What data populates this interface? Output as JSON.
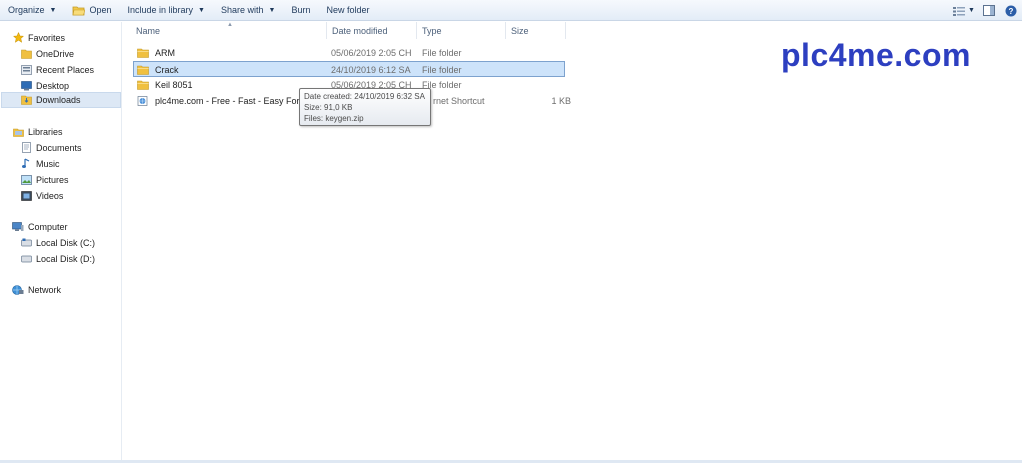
{
  "toolbar": {
    "organize": "Organize",
    "open": "Open",
    "include_in_library": "Include in library",
    "share_with": "Share with",
    "burn": "Burn",
    "new_folder": "New folder"
  },
  "nav": {
    "favorites": "Favorites",
    "onedrive": "OneDrive",
    "recent_places": "Recent Places",
    "desktop": "Desktop",
    "downloads": "Downloads",
    "libraries": "Libraries",
    "documents": "Documents",
    "music": "Music",
    "pictures": "Pictures",
    "videos": "Videos",
    "computer": "Computer",
    "local_c": "Local Disk (C:)",
    "local_d": "Local Disk (D:)",
    "network": "Network"
  },
  "columns": {
    "name": "Name",
    "date_modified": "Date modified",
    "type": "Type",
    "size": "Size"
  },
  "files": [
    {
      "name": "ARM",
      "date": "05/06/2019 2:05 CH",
      "type": "File folder",
      "size": ""
    },
    {
      "name": "Crack",
      "date": "24/10/2019 6:12 SA",
      "type": "File folder",
      "size": ""
    },
    {
      "name": "Keil 8051",
      "date": "05/06/2019 2:05 CH",
      "type": "File folder",
      "size": ""
    },
    {
      "name": "plc4me.com - Free - Fast - Easy For A",
      "date": "",
      "type": "rnet Shortcut",
      "size": "1 KB"
    }
  ],
  "tooltip": {
    "line1": "Date created: 24/10/2019 6:32 SA",
    "line2": "Size: 91,0 KB",
    "line3": "Files: keygen.zip"
  },
  "watermark": "plc4me.com",
  "colors": {
    "selection": "#cde3fa",
    "selection_border": "#7da2ce",
    "watermark": "#2d3fc0",
    "folder": "#f0c040"
  }
}
